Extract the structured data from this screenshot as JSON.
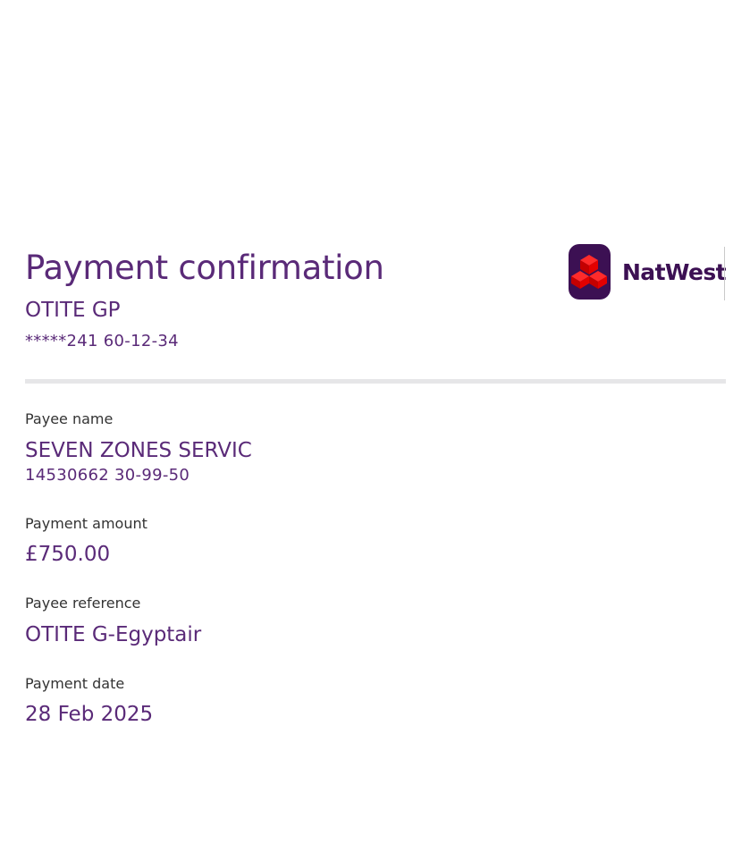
{
  "header": {
    "title": "Payment confirmation",
    "account_name": "OTITE GP",
    "account_number": "*****241 60-12-34"
  },
  "brand": {
    "name": "NatWest",
    "icon": "natwest-logo-icon",
    "colors": {
      "primary": "#3c1053",
      "accent": "#e90000"
    }
  },
  "details": {
    "payee_name_label": "Payee name",
    "payee_name": "SEVEN ZONES SERVIC",
    "payee_account": "14530662 30-99-50",
    "amount_label": "Payment amount",
    "amount": "£750.00",
    "reference_label": "Payee reference",
    "reference": "OTITE G-Egyptair",
    "date_label": "Payment date",
    "date": "28 Feb 2025"
  }
}
